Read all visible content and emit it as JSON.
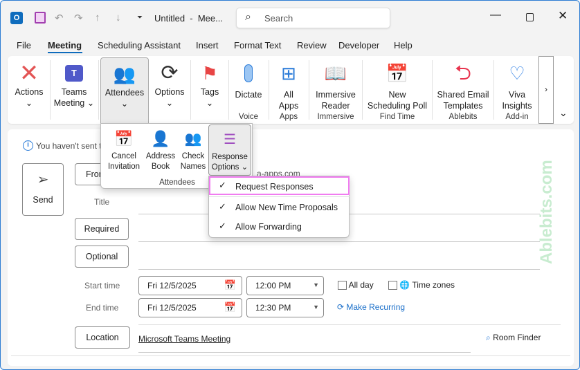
{
  "titlebar": {
    "title": "Untitled  -  Mee...",
    "search_placeholder": "Search"
  },
  "menu_tabs": [
    "File",
    "Meeting",
    "Scheduling Assistant",
    "Insert",
    "Format Text",
    "Review",
    "Developer",
    "Help"
  ],
  "ribbon": {
    "actions": "Actions",
    "teams_l1": "Teams",
    "teams_l2": "Meeting",
    "attendees": "Attendees",
    "options": "Options",
    "tags": "Tags",
    "dictate": "Dictate",
    "all_apps_l1": "All",
    "all_apps_l2": "Apps",
    "immersive_l1": "Immersive",
    "immersive_l2": "Reader",
    "poll_l1": "New",
    "poll_l2": "Scheduling Poll",
    "templates_l1": "Shared Email",
    "templates_l2": "Templates",
    "viva_l1": "Viva",
    "viva_l2": "Insights",
    "groups": {
      "voice": "Voice",
      "apps": "Apps",
      "immersive": "Immersive",
      "find_time": "Find Time",
      "ablebits": "Ablebits",
      "addin": "Add-in"
    }
  },
  "attendees_panel": {
    "cancel_l1": "Cancel",
    "cancel_l2": "Invitation",
    "address_l1": "Address",
    "address_l2": "Book",
    "check_l1": "Check",
    "check_l2": "Names",
    "response_l1": "Response",
    "response_l2": "Options",
    "group": "Attendees"
  },
  "response_menu": [
    "Request Responses",
    "Allow New Time Proposals",
    "Allow Forwarding"
  ],
  "form": {
    "info": "You haven't sent t",
    "send": "Send",
    "from": "From",
    "from_value": "a-apps.com",
    "title_label": "Title",
    "required": "Required",
    "optional": "Optional",
    "start_label": "Start time",
    "end_label": "End time",
    "start_date": "Fri 12/5/2025",
    "start_time": "12:00 PM",
    "end_date": "Fri 12/5/2025",
    "end_time": "12:30 PM",
    "all_day": "All day",
    "time_zones": "Time zones",
    "make_recurring": "Make Recurring",
    "location": "Location",
    "location_value": "Microsoft Teams Meeting",
    "room_finder": "Room Finder"
  },
  "watermark": "Ablebits.com",
  "colors": {
    "accent": "#0f6cbd",
    "highlight": "#f07cf0",
    "watermark": "#c8ecd0"
  }
}
